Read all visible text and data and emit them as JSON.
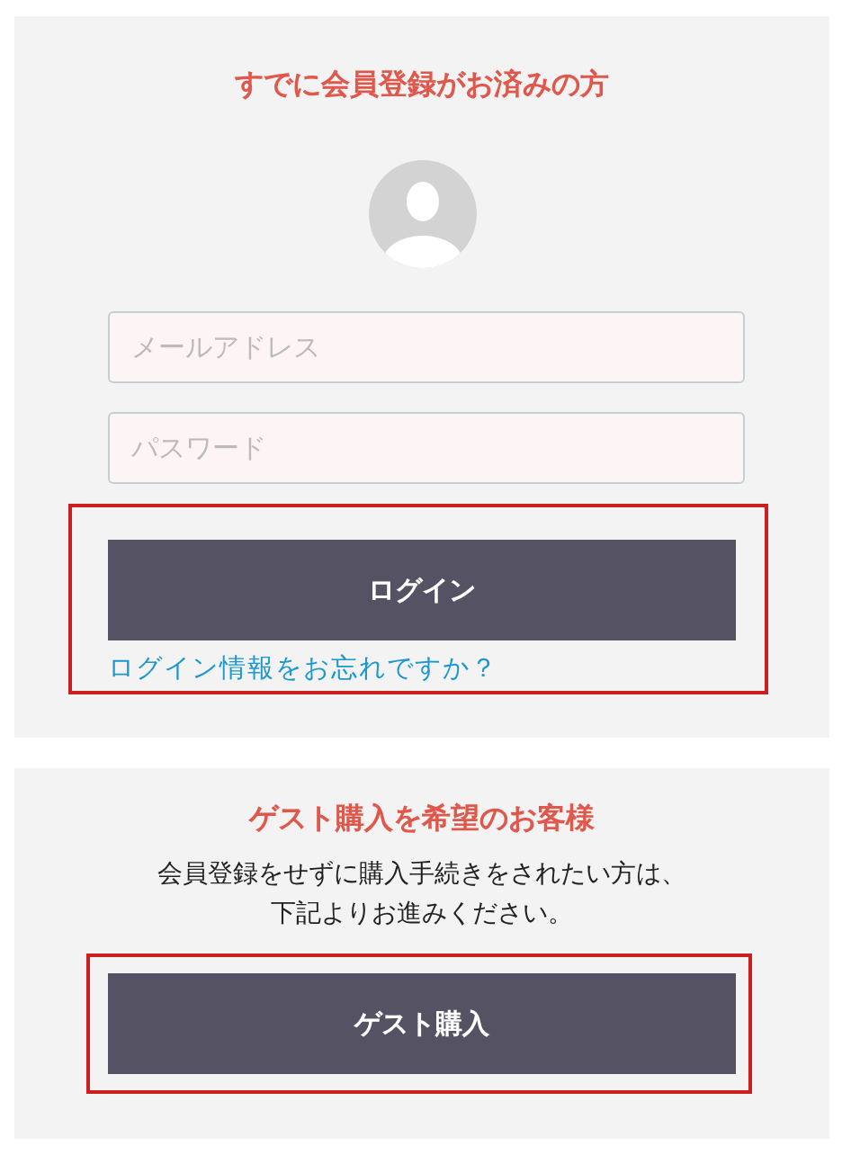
{
  "member": {
    "title": "すでに会員登録がお済みの方",
    "email": {
      "placeholder": "メールアドレス"
    },
    "password": {
      "placeholder": "パスワード"
    },
    "login_group": {
      "highlighted": true,
      "button": "ログイン",
      "forgot_link": "ログイン情報をお忘れですか？"
    }
  },
  "guest": {
    "title": "ゲスト購入を希望のお客様",
    "description": [
      "会員登録をせずに購入手続きをされたい方は、",
      "下記よりお進みください。"
    ],
    "button_group": {
      "highlighted": true,
      "button": "ゲスト購入"
    }
  }
}
